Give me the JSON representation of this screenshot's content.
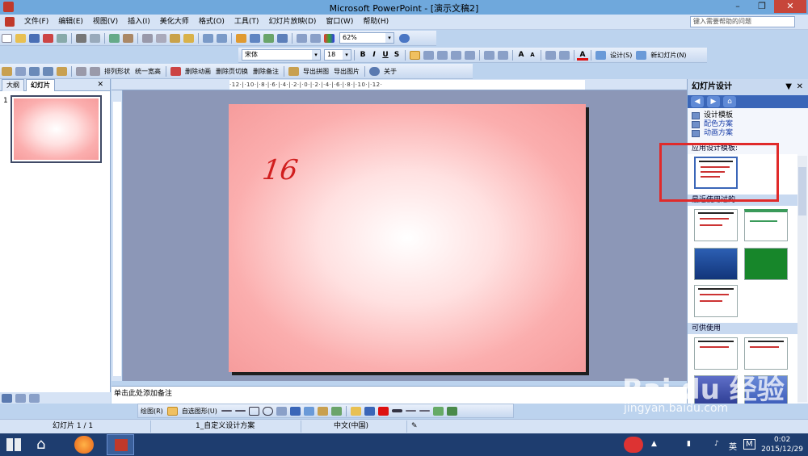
{
  "window": {
    "title": "Microsoft PowerPoint - [演示文稿2]",
    "min_glyph": "–",
    "max_glyph": "❐",
    "close_glyph": "✕"
  },
  "menubar": {
    "items": [
      "文件(F)",
      "编辑(E)",
      "视图(V)",
      "插入(I)",
      "美化大师",
      "格式(O)",
      "工具(T)",
      "幻灯片放映(D)",
      "窗口(W)",
      "帮助(H)"
    ],
    "help_placeholder": "键入需要帮助的问题"
  },
  "standard_toolbar": {
    "zoom": "62%"
  },
  "format_toolbar": {
    "font": "宋体",
    "size": "18",
    "bold": "B",
    "italic": "I",
    "underline": "U",
    "shadow": "S",
    "design_label": "设计(S)",
    "new_slide_label": "新幻灯片(N)",
    "grow_label": "A",
    "shrink_label": "A",
    "font_color_label": "A"
  },
  "addin_toolbar": {
    "items": [
      "排列形状",
      "统一宽高",
      "删除动画",
      "删除页切换",
      "删除备注",
      "导出拼图",
      "导出图片",
      "关于"
    ]
  },
  "left_pane": {
    "tabs": [
      "大纲",
      "幻灯片"
    ],
    "slide_index": "1",
    "close_glyph": "✕"
  },
  "ruler": {
    "h_text": "·12·|·10·|·8·|·6·|·4·|·2·|·0·|·2·|·4·|·6·|·8·|·10·|·12·"
  },
  "slide": {
    "annotation": "16"
  },
  "notes": {
    "placeholder": "单击此处添加备注"
  },
  "task_pane": {
    "title": "幻灯片设计",
    "links": [
      "设计模板",
      "配色方案",
      "动画方案"
    ],
    "sections": [
      "应用设计模板:",
      "最近使用过的",
      "可供使用"
    ]
  },
  "drawing_toolbar": {
    "draw_label": "绘图(R)",
    "autoshape_label": "自选图形(U)"
  },
  "status_bar": {
    "slide_pos": "幻灯片 1 / 1",
    "design": "1_自定义设计方案",
    "language": "中文(中国)"
  },
  "taskbar": {
    "time": "0:02",
    "date": "2015/12/29",
    "ime": "英",
    "ime_mode": "M"
  },
  "watermark": {
    "logo": "Bai du 经验",
    "url": "jingyan.baidu.com"
  },
  "colors": {
    "accent": "#3a66b8",
    "highlight": "#e02a2a",
    "slide_pink": "#f69c9c"
  }
}
